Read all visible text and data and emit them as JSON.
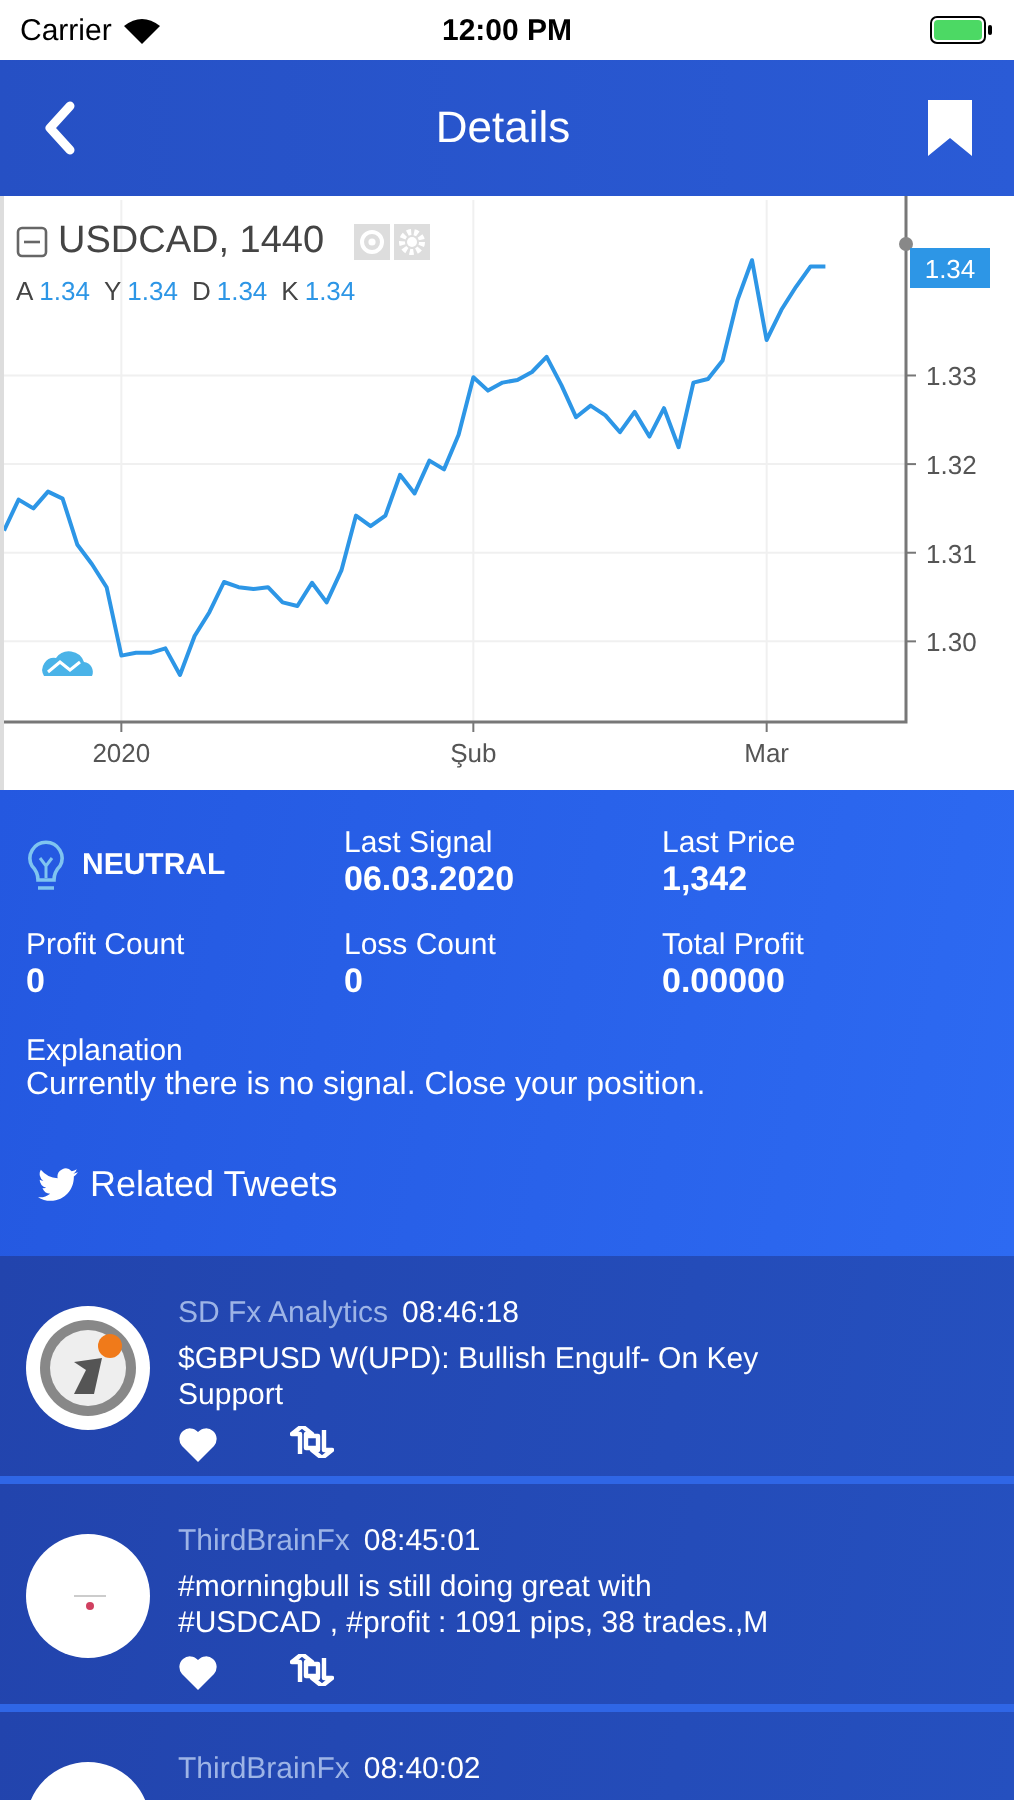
{
  "status_bar": {
    "carrier": "Carrier",
    "time": "12:00 PM"
  },
  "nav": {
    "title": "Details"
  },
  "chart": {
    "interval": ", 1440",
    "ohlc": [
      {
        "label": "A",
        "value": "1.34"
      },
      {
        "label": "Y",
        "value": "1.34"
      },
      {
        "label": "D",
        "value": "1.34"
      },
      {
        "label": "K",
        "value": "1.34"
      }
    ],
    "price_tag": "1.34",
    "chart_data": {
      "type": "line",
      "categories": [
        null,
        null,
        null,
        null,
        null,
        null,
        null,
        null,
        "2020",
        null,
        null,
        null,
        null,
        null,
        null,
        null,
        null,
        null,
        null,
        null,
        null,
        null,
        null,
        null,
        null,
        null,
        null,
        null,
        null,
        null,
        null,
        null,
        "Şub",
        null,
        null,
        null,
        null,
        null,
        null,
        null,
        null,
        null,
        null,
        null,
        null,
        null,
        null,
        null,
        null,
        null,
        null,
        null,
        "Mar",
        null,
        null,
        null,
        null
      ],
      "series": [
        {
          "name": "USDCAD",
          "color": "#2d96e6",
          "values": [
            1.3125,
            1.316,
            1.315,
            1.3169,
            1.3161,
            1.3109,
            1.3087,
            1.3061,
            1.2984,
            1.2987,
            1.2987,
            1.2992,
            1.2962,
            1.3006,
            1.3033,
            1.3067,
            1.3061,
            1.3059,
            1.3061,
            1.3044,
            1.304,
            1.3066,
            1.3044,
            1.308,
            1.3142,
            1.313,
            1.3142,
            1.3188,
            1.3167,
            1.3204,
            1.3194,
            1.3233,
            1.3298,
            1.3283,
            1.3292,
            1.3295,
            1.3304,
            1.3321,
            1.3289,
            1.3253,
            1.3266,
            1.3255,
            1.3236,
            1.3259,
            1.3231,
            1.3263,
            1.3219,
            1.3292,
            1.3296,
            1.3317,
            1.3385,
            1.343,
            1.334,
            1.3374,
            1.34,
            1.3423,
            1.3423
          ]
        }
      ],
      "grid": true,
      "ylim": [
        1.2909,
        1.3498
      ],
      "yticks": [
        {
          "value": 1.3,
          "label": "1.30"
        },
        {
          "value": 1.31,
          "label": "1.31"
        },
        {
          "value": 1.32,
          "label": "1.32"
        },
        {
          "value": 1.33,
          "label": "1.33"
        }
      ]
    }
  },
  "signal": {
    "status": "NEUTRAL",
    "stats": [
      {
        "label": "Last Signal",
        "value": "06.03.2020"
      },
      {
        "label": "Last Price",
        "value": "1,342"
      },
      {
        "label": "Profit Count",
        "value": "0"
      },
      {
        "label": "Loss Count",
        "value": "0"
      },
      {
        "label": "Total Profit",
        "value": "0.00000"
      }
    ],
    "explanation_label": "Explanation",
    "explanation": "Currently there is no signal. Close your position."
  },
  "tweets_header": "Related Tweets",
  "tweets": [
    {
      "kind": "logo",
      "author": "SD Fx Analytics",
      "time": "08:46:18",
      "text": "$GBPUSD W(UPD): Bullish Engulf- On Key Support"
    },
    {
      "kind": "plain",
      "author": "ThirdBrainFx",
      "time": "08:45:01",
      "text": "#morningbull is still doing great with #USDCAD , #profit : 1091 pips, 38 trades.,M"
    },
    {
      "kind": "plain",
      "author": "ThirdBrainFx",
      "time": "08:40:02"
    }
  ]
}
